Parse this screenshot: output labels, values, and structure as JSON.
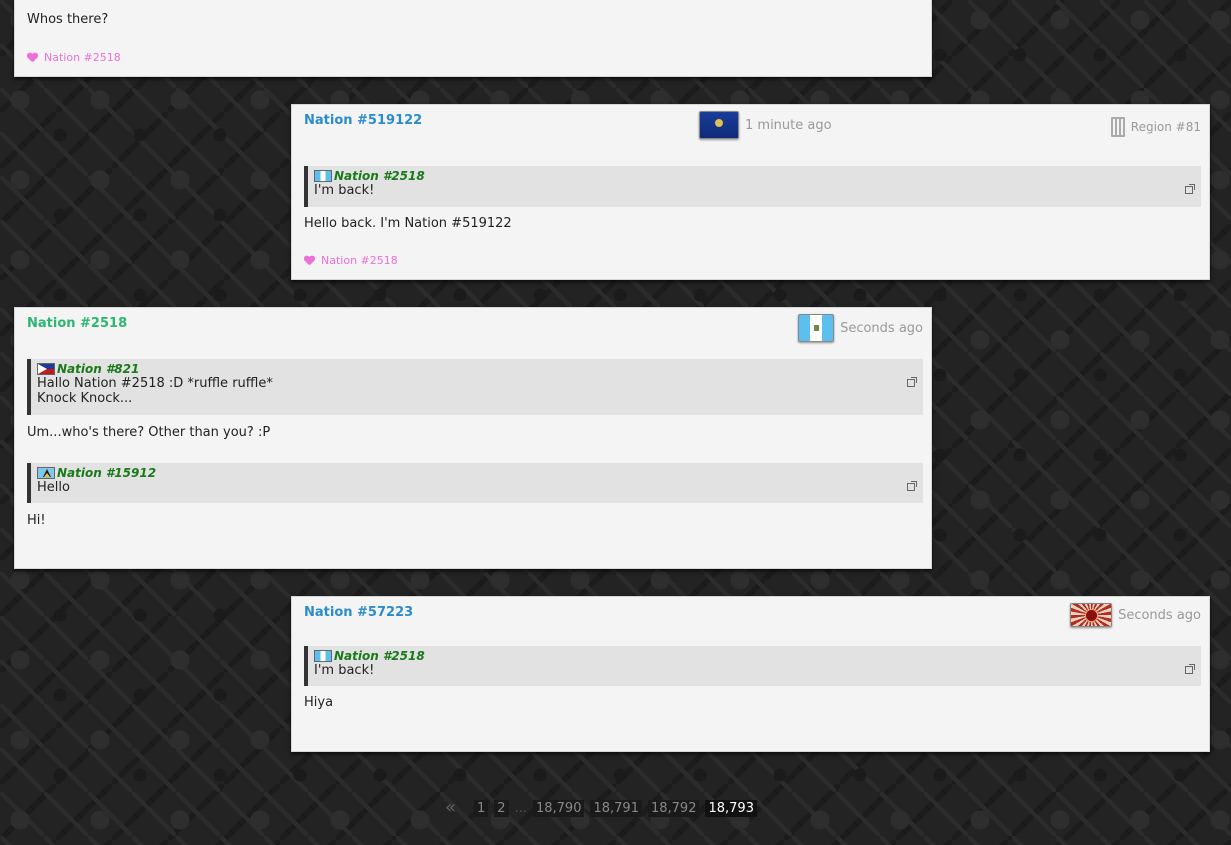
{
  "posts": [
    {
      "body": "Whos there?",
      "like": "Nation #2518"
    },
    {
      "author": "Nation #519122",
      "time": "1 minute ago",
      "region": "Region #81",
      "quote": {
        "author": "Nation #2518",
        "lines": [
          "I'm back!"
        ]
      },
      "body": "Hello back. I'm Nation #519122",
      "like": "Nation #2518"
    },
    {
      "author": "Nation #2518",
      "time": "Seconds ago",
      "quote1": {
        "author": "Nation #821",
        "lines": [
          "Hallo Nation #2518 :D *ruffle ruffle*",
          "Knock Knock..."
        ]
      },
      "body1": "Um...who's there? Other than you? :P",
      "quote2": {
        "author": "Nation #15912",
        "lines": [
          "Hello"
        ]
      },
      "body2": "Hi!"
    },
    {
      "author": "Nation #57223",
      "time": "Seconds ago",
      "quote": {
        "author": "Nation #2518",
        "lines": [
          "I'm back!"
        ]
      },
      "body": "Hiya"
    }
  ],
  "pagination": {
    "prev": "«",
    "pages": [
      "1",
      "2",
      "18,790",
      "18,791",
      "18,792",
      "18,793"
    ],
    "ellipsis": "...",
    "current": "18,793"
  },
  "icons": {
    "heart": "heart-icon",
    "building": "building-icon",
    "external": "external-link-icon",
    "flag": "flag-icon"
  },
  "colors": {
    "author_blue": "#2a8ccd",
    "author_green": "#2bb673",
    "quote_author": "#1a7a1a",
    "like_pink": "#ee6fd7"
  }
}
